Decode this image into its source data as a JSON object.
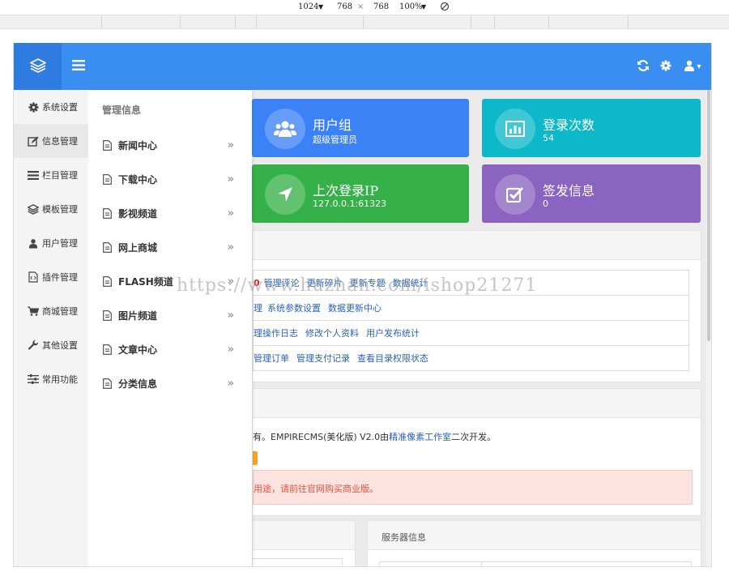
{
  "devtools": {
    "width": "1024",
    "height": "768",
    "times": "×",
    "zoom": "100%",
    "arrow": "▼"
  },
  "topbar": {
    "logo_icon": "layers-icon",
    "menu_icon": "bars-icon",
    "refresh_icon": "refresh-icon",
    "settings_icon": "gear-icon",
    "user_icon": "user-icon",
    "user_caret": "▾"
  },
  "sidebar": {
    "items": [
      {
        "label": "系统设置",
        "icon": "gear-icon"
      },
      {
        "label": "信息管理",
        "icon": "edit-icon"
      },
      {
        "label": "栏目管理",
        "icon": "list-icon"
      },
      {
        "label": "模板管理",
        "icon": "layers-icon"
      },
      {
        "label": "用户管理",
        "icon": "user-icon"
      },
      {
        "label": "插件管理",
        "icon": "code-file-icon"
      },
      {
        "label": "商城管理",
        "icon": "cart-icon"
      },
      {
        "label": "其他设置",
        "icon": "wrench-icon"
      },
      {
        "label": "常用功能",
        "icon": "sliders-icon"
      }
    ]
  },
  "submenu": {
    "title": "管理信息",
    "arrow": "»",
    "items": [
      {
        "label": "新闻中心"
      },
      {
        "label": "下载中心"
      },
      {
        "label": "影视频道"
      },
      {
        "label": "网上商城"
      },
      {
        "label": "FLASH频道"
      },
      {
        "label": "图片频道"
      },
      {
        "label": "文章中心"
      },
      {
        "label": "分类信息"
      }
    ]
  },
  "cards": [
    {
      "title": "用户组",
      "value": "超级管理员",
      "color": "#3b82f6",
      "icon": "users-icon"
    },
    {
      "title": "登录次数",
      "value": "54",
      "color": "#0db8c8",
      "icon": "bar-chart-icon"
    },
    {
      "title": "上次登录IP",
      "value": "127.0.0.1:61323",
      "color": "#36b14a",
      "icon": "location-arrow-icon"
    },
    {
      "title": "签发信息",
      "value": "0",
      "color": "#8a64c0",
      "icon": "check-square-icon"
    }
  ],
  "links": {
    "row1_prefix": "0",
    "row1": [
      "管理评论",
      "更新碎片",
      "更新专题",
      "数据统计"
    ],
    "row2_prefix": "理",
    "row2": [
      "系统参数设置",
      "数据更新中心"
    ],
    "row3": [
      "理操作日志",
      "修改个人资料",
      "用户发布统计"
    ],
    "row4": [
      "管理订单",
      "管理支付记录",
      "查看目录权限状态"
    ]
  },
  "copyright": {
    "text_prefix": "有。EMPIRECMS(美化版) V2.0由",
    "link": "精准像素工作室",
    "text_suffix": "二次开发。",
    "warning": "用途，请前往官网购买商业版。"
  },
  "server_panel": {
    "title": "服务器信息"
  },
  "watermark": "https://www.huzhan.com/ishop21271",
  "colors": {
    "topbar": "#3a8ef0",
    "logo_bg": "#2f7ce0",
    "warning_bg": "#fde3e0",
    "warning_text": "#e0533c",
    "orange": "#f5a623"
  }
}
